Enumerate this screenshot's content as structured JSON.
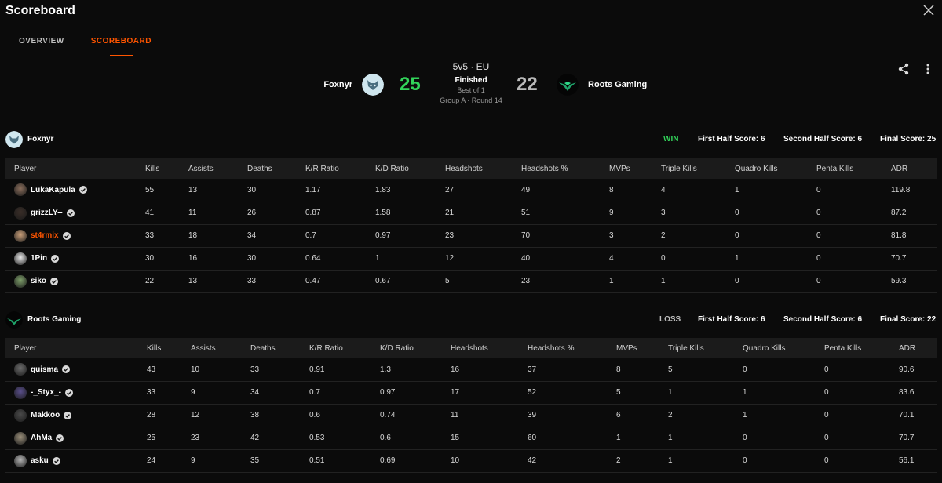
{
  "window": {
    "title": "Scoreboard"
  },
  "tabs": [
    {
      "label": "OVERVIEW",
      "active": false
    },
    {
      "label": "SCOREBOARD",
      "active": true
    }
  ],
  "match": {
    "mode": "5v5 · EU",
    "status": "Finished",
    "best_of": "Best of 1",
    "round": "Group A · Round 14",
    "team1": {
      "name": "Foxnyr",
      "score": "25"
    },
    "team2": {
      "name": "Roots Gaming",
      "score": "22"
    }
  },
  "icons": {
    "close": "close-icon",
    "share": "share-icon",
    "more": "more-vertical-icon",
    "verified": "verified-icon"
  },
  "colors": {
    "accent": "#ff5500",
    "win": "#32d35a",
    "background": "#0b0b0b",
    "header_row": "#1b1b1b"
  },
  "columns": [
    "Player",
    "Kills",
    "Assists",
    "Deaths",
    "K/R Ratio",
    "K/D Ratio",
    "Headshots",
    "Headshots %",
    "MVPs",
    "Triple Kills",
    "Quadro Kills",
    "Penta Kills",
    "ADR"
  ],
  "teams": [
    {
      "name": "Foxnyr",
      "result": "WIN",
      "first_half": "First Half Score: 6",
      "second_half": "Second Half Score: 6",
      "final": "Final Score: 25",
      "players": [
        {
          "name": "LukaKapula",
          "stats": [
            "55",
            "13",
            "30",
            "1.17",
            "1.83",
            "27",
            "49",
            "8",
            "4",
            "1",
            "0",
            "119.8"
          ]
        },
        {
          "name": "grizzLY--",
          "stats": [
            "41",
            "11",
            "26",
            "0.87",
            "1.58",
            "21",
            "51",
            "9",
            "3",
            "0",
            "0",
            "87.2"
          ]
        },
        {
          "name": "st4rmix",
          "stats": [
            "33",
            "18",
            "34",
            "0.7",
            "0.97",
            "23",
            "70",
            "3",
            "2",
            "0",
            "0",
            "81.8"
          ]
        },
        {
          "name": "1Pin",
          "stats": [
            "30",
            "16",
            "30",
            "0.64",
            "1",
            "12",
            "40",
            "4",
            "0",
            "1",
            "0",
            "70.7"
          ]
        },
        {
          "name": "siko",
          "stats": [
            "22",
            "13",
            "33",
            "0.47",
            "0.67",
            "5",
            "23",
            "1",
            "1",
            "0",
            "0",
            "59.3"
          ]
        }
      ]
    },
    {
      "name": "Roots Gaming",
      "result": "LOSS",
      "first_half": "First Half Score: 6",
      "second_half": "Second Half Score: 6",
      "final": "Final Score: 22",
      "players": [
        {
          "name": "quisma",
          "stats": [
            "43",
            "10",
            "33",
            "0.91",
            "1.3",
            "16",
            "37",
            "8",
            "5",
            "0",
            "0",
            "90.6"
          ]
        },
        {
          "name": "-_Styx_-",
          "stats": [
            "33",
            "9",
            "34",
            "0.7",
            "0.97",
            "17",
            "52",
            "5",
            "1",
            "1",
            "0",
            "83.6"
          ]
        },
        {
          "name": "Makkoo",
          "stats": [
            "28",
            "12",
            "38",
            "0.6",
            "0.74",
            "11",
            "39",
            "6",
            "2",
            "1",
            "0",
            "70.1"
          ]
        },
        {
          "name": "AhMa",
          "stats": [
            "25",
            "23",
            "42",
            "0.53",
            "0.6",
            "15",
            "60",
            "1",
            "1",
            "0",
            "0",
            "70.7"
          ]
        },
        {
          "name": "asku",
          "stats": [
            "24",
            "9",
            "35",
            "0.51",
            "0.69",
            "10",
            "42",
            "2",
            "1",
            "0",
            "0",
            "56.1"
          ]
        }
      ]
    }
  ]
}
